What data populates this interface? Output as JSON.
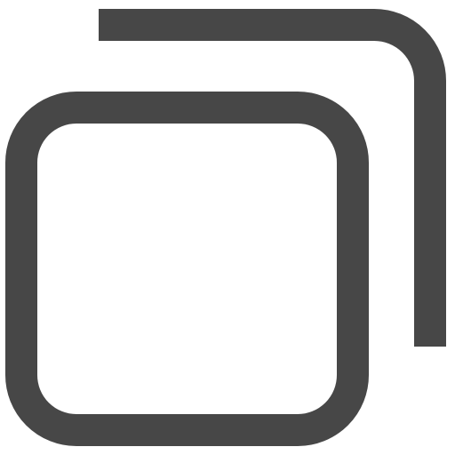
{
  "icon": {
    "name": "copy-icon",
    "stroke_color": "#474747",
    "background_color": "#ffffff"
  }
}
